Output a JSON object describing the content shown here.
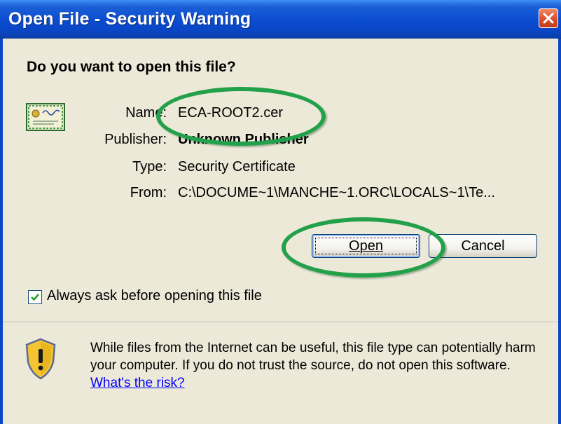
{
  "window": {
    "title": "Open File - Security Warning"
  },
  "dialog": {
    "question": "Do you want to open this file?",
    "fields": [
      {
        "label": "Name:",
        "value": "ECA-ROOT2.cer"
      },
      {
        "label": "Publisher:",
        "value": "Unknown Publisher"
      },
      {
        "label": "Type:",
        "value": "Security Certificate"
      },
      {
        "label": "From:",
        "value": "C:\\DOCUME~1\\MANCHE~1.ORC\\LOCALS~1\\Te..."
      }
    ],
    "open_label": "Open",
    "cancel_label": "Cancel",
    "always_ask": {
      "checked": true,
      "label": "Always ask before opening this file"
    },
    "warning": {
      "text": "While files from the Internet can be useful, this file type can potentially harm your computer. If you do not trust the source, do not open this software.",
      "link": "What's the risk?"
    }
  },
  "colors": {
    "titlebar": "#0b4cd0",
    "highlight": "#22a04a",
    "link": "#0000ff"
  },
  "icons": {
    "file": "certificate-icon",
    "warning": "warning-shield-icon",
    "close": "close-icon"
  }
}
